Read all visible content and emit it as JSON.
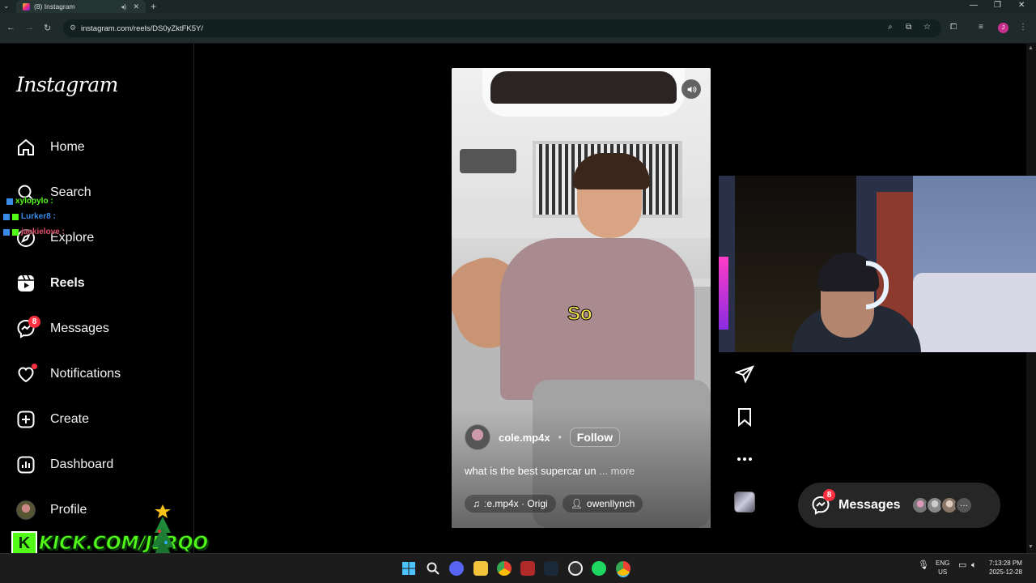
{
  "browser": {
    "tab_title": "(8) Instagram",
    "url": "instagram.com/reels/DS0yZktFK5Y/"
  },
  "sidebar": {
    "logo": "Instagram",
    "items": [
      {
        "label": "Home",
        "icon": "home-icon"
      },
      {
        "label": "Search",
        "icon": "search-icon"
      },
      {
        "label": "Explore",
        "icon": "compass-icon"
      },
      {
        "label": "Reels",
        "icon": "reels-icon"
      },
      {
        "label": "Messages",
        "icon": "messenger-icon",
        "badge": "8"
      },
      {
        "label": "Notifications",
        "icon": "heart-icon"
      },
      {
        "label": "Create",
        "icon": "plus-square-icon"
      },
      {
        "label": "Dashboard",
        "icon": "chart-icon"
      },
      {
        "label": "Profile",
        "icon": "avatar-icon"
      }
    ]
  },
  "chat_overlay": [
    {
      "user": "xylopylo :",
      "color": "#53fc18"
    },
    {
      "user": "Lurker8 :",
      "color": "#3a8be8"
    },
    {
      "user": "jackielove :",
      "color": "#e0506a"
    }
  ],
  "reel": {
    "caption_overlay": "So",
    "username": "cole.mp4x",
    "separator": "•",
    "follow_label": "Follow",
    "caption": "what is the best supercar un",
    "more_label": "... more",
    "audio": "ːe.mp4x · Origi",
    "collab": "owenllynch"
  },
  "messages_pill": {
    "label": "Messages",
    "badge": "8",
    "more": "···"
  },
  "stream": {
    "kick_label": "KICK.COM/JERQO"
  },
  "taskbar": {
    "lang_top": "ENG",
    "lang_bottom": "US",
    "time": "7:13:28 PM",
    "date": "2025-12-28"
  },
  "colors": {
    "badge": "#ff3040",
    "kick_green": "#53fc18",
    "caption_yellow": "#f7e54d"
  }
}
